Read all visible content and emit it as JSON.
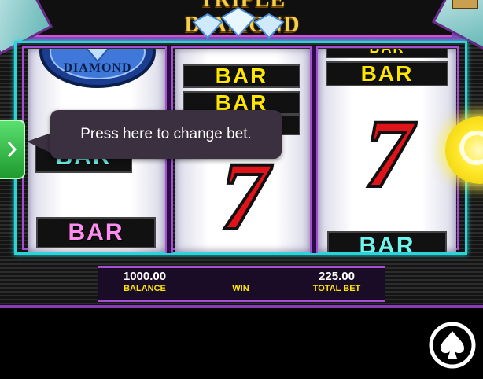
{
  "game": {
    "logo_text": "TRIPLE DIAMOND",
    "reel1_logo_text": "DIAMOND"
  },
  "reels": [
    {
      "symbols": [
        {
          "type": "diamond-logo",
          "label": "DIAMOND"
        },
        {
          "type": "bar",
          "label": "BAR",
          "color": "cyan"
        },
        {
          "type": "bar",
          "label": "BAR",
          "color": "pink"
        }
      ]
    },
    {
      "symbols": [
        {
          "type": "bar",
          "label": "BAR",
          "color": "yellow"
        },
        {
          "type": "bar",
          "label": "BAR",
          "color": "yellow"
        },
        {
          "type": "bar",
          "label": "BAR",
          "color": "yellow"
        },
        {
          "type": "seven",
          "label": "7"
        }
      ]
    },
    {
      "symbols": [
        {
          "type": "bar",
          "label": "BAR",
          "color": "yellow"
        },
        {
          "type": "bar",
          "label": "BAR",
          "color": "yellow"
        },
        {
          "type": "seven",
          "label": "7"
        },
        {
          "type": "bar",
          "label": "BAR",
          "color": "cyan"
        }
      ]
    }
  ],
  "tooltip": {
    "text": "Press here to change bet."
  },
  "info": {
    "balance_value": "1000.00",
    "balance_label": "BALANCE",
    "win_label": "WIN",
    "total_bet_value": "225.00",
    "total_bet_label": "TOTAL BET"
  },
  "icons": {
    "bet_button": "chevron-right-icon",
    "spin_button": "spin-icon",
    "brand": "spade-logo-icon"
  },
  "colors": {
    "frame_cyan": "#2bd4d8",
    "frame_purple": "#a64fd6",
    "bar_yellow": "#ffe600",
    "bar_pink": "#ff8cf0",
    "bar_cyan": "#6ff5ee",
    "seven_red": "#e0121a",
    "bet_green": "#2fbf45",
    "spin_yellow": "#ffe82a",
    "label_yellow": "#ffe600"
  }
}
